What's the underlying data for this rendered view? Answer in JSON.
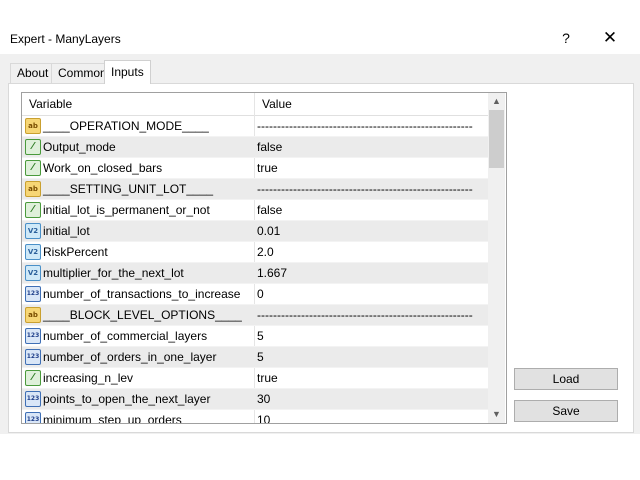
{
  "window": {
    "title": "Expert - ManyLayers",
    "help_label": "?",
    "close_label": "✕"
  },
  "tabs": [
    {
      "label": "About"
    },
    {
      "label": "Common"
    },
    {
      "label": "Inputs"
    }
  ],
  "grid": {
    "columns": [
      "Variable",
      "Value"
    ],
    "rows": [
      {
        "icon": "ab",
        "name": "____OPERATION_MODE____",
        "value": "------------------------------------------------------"
      },
      {
        "icon": "bool",
        "name": "Output_mode",
        "value": "false"
      },
      {
        "icon": "bool",
        "name": "Work_on_closed_bars",
        "value": "true"
      },
      {
        "icon": "ab",
        "name": "____SETTING_UNIT_LOT____",
        "value": "------------------------------------------------------"
      },
      {
        "icon": "bool",
        "name": "initial_lot_is_permanent_or_not",
        "value": "false"
      },
      {
        "icon": "dbl",
        "name": "initial_lot",
        "value": "0.01"
      },
      {
        "icon": "dbl",
        "name": "RiskPercent",
        "value": "2.0"
      },
      {
        "icon": "dbl",
        "name": "multiplier_for_the_next_lot",
        "value": "1.667"
      },
      {
        "icon": "int",
        "name": "number_of_transactions_to_increase",
        "value": "0"
      },
      {
        "icon": "ab",
        "name": "____BLOCK_LEVEL_OPTIONS____",
        "value": "------------------------------------------------------"
      },
      {
        "icon": "int",
        "name": "number_of_commercial_layers",
        "value": "5"
      },
      {
        "icon": "int",
        "name": "number_of_orders_in_one_layer",
        "value": "5"
      },
      {
        "icon": "bool",
        "name": "increasing_n_lev",
        "value": "true"
      },
      {
        "icon": "int",
        "name": "points_to_open_the_next_layer",
        "value": "30"
      },
      {
        "icon": "int",
        "name": "minimum_step_up_orders",
        "value": "10"
      }
    ]
  },
  "icons": {
    "ab": {
      "name": "string-icon",
      "glyph": "ab"
    },
    "bool": {
      "name": "bool-icon",
      "glyph": "⁄"
    },
    "dbl": {
      "name": "double-icon",
      "glyph": "V2"
    },
    "int": {
      "name": "integer-icon",
      "glyph": "123"
    }
  },
  "scroll": {
    "up": "▲",
    "down": "▼"
  },
  "buttons": {
    "load": "Load",
    "save": "Save"
  }
}
